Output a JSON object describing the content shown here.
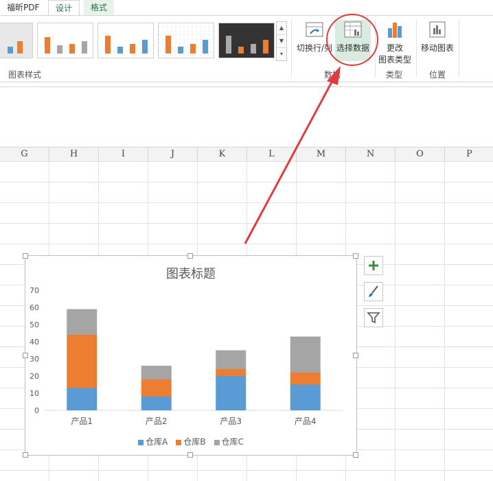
{
  "tabs": [
    {
      "label": "福昕PDF",
      "active": false
    },
    {
      "label": "设计",
      "active": true
    },
    {
      "label": "格式",
      "active": false
    }
  ],
  "ribbon": {
    "styles_group_label": "图表样式",
    "data_group_label": "数据",
    "type_group_label": "类型",
    "location_group_label": "位置",
    "switch_row_col_label": "切换行/列",
    "select_data_label": "选择数据",
    "change_type_label_line1": "更改",
    "change_type_label_line2": "图表类型",
    "move_chart_label": "移动图表"
  },
  "columns": [
    "G",
    "H",
    "I",
    "J",
    "K",
    "L",
    "M",
    "N",
    "O",
    "P"
  ],
  "chart_side_buttons": [
    "plus-icon",
    "brush-icon",
    "filter-icon"
  ],
  "chart_data": {
    "type": "bar",
    "stacked": true,
    "title": "图表标题",
    "categories": [
      "产品1",
      "产品2",
      "产品3",
      "产品4"
    ],
    "series": [
      {
        "name": "仓库A",
        "values": [
          13,
          8,
          20,
          15
        ],
        "color": "#5b9bd5"
      },
      {
        "name": "仓库B",
        "values": [
          31,
          10,
          4,
          7
        ],
        "color": "#ed7d31"
      },
      {
        "name": "仓库C",
        "values": [
          15,
          8,
          11,
          21
        ],
        "color": "#a5a5a5"
      }
    ],
    "ylim": [
      0,
      70
    ],
    "yticks": [
      0,
      10,
      20,
      30,
      40,
      50,
      60,
      70
    ],
    "grid": false,
    "legend_position": "bottom"
  },
  "colors": {
    "accent": "#217346",
    "annotation": "#e03c3c"
  }
}
